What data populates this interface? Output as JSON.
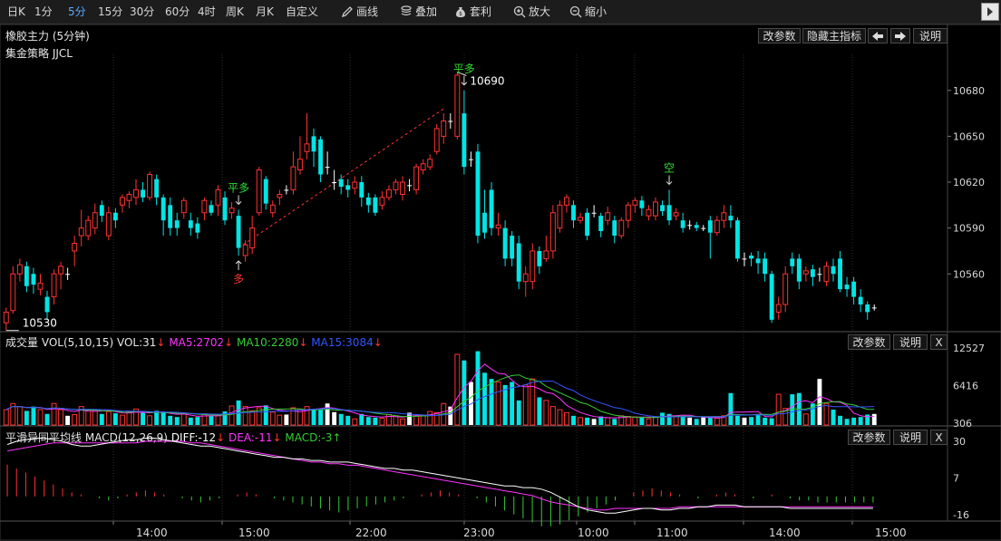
{
  "toolbar": {
    "periods": [
      "日K",
      "1分",
      "5分",
      "15分",
      "30分",
      "60分",
      "4时",
      "周K",
      "月K",
      "自定义"
    ],
    "active_period": "5分",
    "tools": [
      {
        "label": "画线",
        "icon": "pen-icon"
      },
      {
        "label": "叠加",
        "icon": "stack-icon"
      },
      {
        "label": "套利",
        "icon": "money-bag-icon"
      },
      {
        "label": "放大",
        "icon": "zoom-in-icon"
      },
      {
        "label": "缩小",
        "icon": "zoom-out-icon"
      }
    ]
  },
  "main_panel": {
    "title": "橡胶主力 (5分钟)",
    "strategy": "集金策略 JJCL",
    "buttons": {
      "params": "改参数",
      "hide": "隐藏主指标",
      "left": "◀",
      "right": "➡",
      "help": "说明"
    },
    "y_ticks": [
      "10680",
      "10650",
      "10620",
      "10590",
      "10560"
    ],
    "annotations": {
      "high": "10690",
      "low": "10530",
      "signal_close_long_1": "平多",
      "signal_close_long_2": "平多",
      "signal_long": "多",
      "signal_short": "空"
    }
  },
  "volume_panel": {
    "name": "成交量",
    "indicator": "VOL(5,10,15)",
    "vol": "VOL:31",
    "ma5": "MA5:2702",
    "ma10": "MA10:2280",
    "ma15": "MA15:3084",
    "y_ticks": [
      "12527",
      "6416",
      "306"
    ],
    "buttons": {
      "params": "改参数",
      "help": "说明",
      "close": "X"
    }
  },
  "macd_panel": {
    "name": "平滑异同平均线",
    "indicator": "MACD(12,26,9)",
    "diff": "DIFF:-12",
    "dea": "DEA:-11",
    "macd": "MACD:-3",
    "y_ticks": [
      "30",
      "7",
      "-16"
    ],
    "buttons": {
      "params": "改参数",
      "help": "说明",
      "close": "X"
    }
  },
  "x_ticks": [
    "14:00",
    "15:00",
    "22:00",
    "23:00",
    "10:00",
    "11:00",
    "14:00",
    "15:00"
  ],
  "colors": {
    "up": "#ff3232",
    "down": "#00e5e5",
    "flat": "#ffffff",
    "ma5": "#ff33ff",
    "ma10": "#33cc33",
    "ma15": "#3355ff",
    "diff": "#ffffff",
    "dea": "#ff33ff",
    "active": "#5aa9ff"
  },
  "chart_data": [
    {
      "type": "candlestick",
      "title": "橡胶主力 (5分钟)",
      "ylim": [
        10524,
        10700
      ],
      "bars": [
        [
          10528,
          10535,
          10523,
          10538
        ],
        [
          10536,
          10560,
          10534,
          10565
        ],
        [
          10560,
          10566,
          10555,
          10570
        ],
        [
          10565,
          10552,
          10548,
          10568
        ],
        [
          10560,
          10553,
          10547,
          10564
        ],
        [
          10550,
          10554,
          10546,
          10560
        ],
        [
          10545,
          10535,
          10530,
          10549
        ],
        [
          10545,
          10560,
          10540,
          10563
        ],
        [
          10560,
          10565,
          10550,
          10568
        ],
        [
          10560,
          10560,
          10556,
          10564
        ],
        [
          10575,
          10580,
          10565,
          10585
        ],
        [
          10585,
          10590,
          10578,
          10602
        ],
        [
          10585,
          10595,
          10582,
          10598
        ],
        [
          10590,
          10600,
          10586,
          10606
        ],
        [
          10605,
          10598,
          10594,
          10608
        ],
        [
          10585,
          10600,
          10582,
          10604
        ],
        [
          10600,
          10595,
          10590,
          10603
        ],
        [
          10605,
          10610,
          10600,
          10612
        ],
        [
          10608,
          10612,
          10603,
          10614
        ],
        [
          10610,
          10615,
          10605,
          10622
        ],
        [
          10615,
          10610,
          10607,
          10620
        ],
        [
          10610,
          10625,
          10608,
          10627
        ],
        [
          10622,
          10610,
          10605,
          10625
        ],
        [
          10610,
          10595,
          10585,
          10612
        ],
        [
          10605,
          10590,
          10585,
          10610
        ],
        [
          10595,
          10590,
          10585,
          10600
        ],
        [
          10600,
          10608,
          10596,
          10610
        ],
        [
          10595,
          10590,
          10585,
          10600
        ],
        [
          10593,
          10587,
          10583,
          10597
        ],
        [
          10600,
          10608,
          10595,
          10610
        ],
        [
          10605,
          10600,
          10598,
          10608
        ],
        [
          10605,
          10615,
          10598,
          10618
        ],
        [
          10610,
          10595,
          10592,
          10614
        ],
        [
          10600,
          10603,
          10596,
          10607
        ],
        [
          10598,
          10577,
          10572,
          10602
        ],
        [
          10572,
          10579,
          10568,
          10582
        ],
        [
          10577,
          10590,
          10573,
          10598
        ],
        [
          10600,
          10628,
          10598,
          10630
        ],
        [
          10622,
          10606,
          10602,
          10624
        ],
        [
          10600,
          10605,
          10597,
          10608
        ],
        [
          10610,
          10612,
          10605,
          10615
        ],
        [
          10615,
          10615,
          10612,
          10618
        ],
        [
          10615,
          10630,
          10612,
          10640
        ],
        [
          10628,
          10635,
          10625,
          10650
        ],
        [
          10640,
          10645,
          10635,
          10665
        ],
        [
          10650,
          10640,
          10630,
          10655
        ],
        [
          10648,
          10625,
          10620,
          10650
        ],
        [
          10630,
          10630,
          10625,
          10640
        ],
        [
          10620,
          10620,
          10615,
          10628
        ],
        [
          10622,
          10617,
          10612,
          10625
        ],
        [
          10618,
          10615,
          10610,
          10622
        ],
        [
          10616,
          10620,
          10612,
          10624
        ],
        [
          10620,
          10610,
          10604,
          10624
        ],
        [
          10610,
          10605,
          10600,
          10613
        ],
        [
          10610,
          10600,
          10598,
          10612
        ],
        [
          10605,
          10610,
          10602,
          10614
        ],
        [
          10610,
          10615,
          10608,
          10618
        ],
        [
          10615,
          10620,
          10612,
          10622
        ],
        [
          10612,
          10620,
          10608,
          10624
        ],
        [
          10618,
          10618,
          10614,
          10622
        ],
        [
          10615,
          10630,
          10612,
          10632
        ],
        [
          10628,
          10632,
          10625,
          10635
        ],
        [
          10630,
          10635,
          10628,
          10638
        ],
        [
          10640,
          10655,
          10638,
          10658
        ],
        [
          10650,
          10660,
          10645,
          10665
        ],
        [
          10660,
          10660,
          10655,
          10665
        ],
        [
          10650,
          10690,
          10648,
          10692
        ],
        [
          10665,
          10630,
          10625,
          10680
        ],
        [
          10635,
          10635,
          10630,
          10640
        ],
        [
          10640,
          10585,
          10580,
          10645
        ],
        [
          10600,
          10587,
          10583,
          10615
        ],
        [
          10615,
          10590,
          10585,
          10620
        ],
        [
          10590,
          10592,
          10585,
          10600
        ],
        [
          10590,
          10570,
          10565,
          10595
        ],
        [
          10585,
          10570,
          10565,
          10588
        ],
        [
          10580,
          10555,
          10550,
          10585
        ],
        [
          10555,
          10560,
          10545,
          10565
        ],
        [
          10555,
          10575,
          10550,
          10580
        ],
        [
          10575,
          10565,
          10560,
          10578
        ],
        [
          10570,
          10575,
          10568,
          10585
        ],
        [
          10575,
          10600,
          10570,
          10605
        ],
        [
          10590,
          10605,
          10587,
          10608
        ],
        [
          10605,
          10610,
          10600,
          10612
        ],
        [
          10605,
          10595,
          10590,
          10608
        ],
        [
          10595,
          10597,
          10593,
          10600
        ],
        [
          10600,
          10585,
          10582,
          10603
        ],
        [
          10600,
          10600,
          10597,
          10605
        ],
        [
          10598,
          10588,
          10584,
          10600
        ],
        [
          10595,
          10600,
          10592,
          10604
        ],
        [
          10595,
          10585,
          10580,
          10598
        ],
        [
          10585,
          10595,
          10583,
          10597
        ],
        [
          10595,
          10605,
          10590,
          10607
        ],
        [
          10605,
          10608,
          10600,
          10610
        ],
        [
          10608,
          10603,
          10598,
          10611
        ],
        [
          10598,
          10602,
          10595,
          10605
        ],
        [
          10598,
          10607,
          10595,
          10610
        ],
        [
          10605,
          10601,
          10598,
          10608
        ],
        [
          10605,
          10595,
          10592,
          10615
        ],
        [
          10598,
          10600,
          10595,
          10603
        ],
        [
          10595,
          10590,
          10587,
          10600
        ],
        [
          10592,
          10592,
          10589,
          10595
        ],
        [
          10592,
          10590,
          10588,
          10594
        ],
        [
          10590,
          10590,
          10588,
          10592
        ],
        [
          10595,
          10587,
          10570,
          10598
        ],
        [
          10587,
          10595,
          10585,
          10598
        ],
        [
          10595,
          10600,
          10590,
          10605
        ],
        [
          10598,
          10595,
          10590,
          10605
        ],
        [
          10595,
          10570,
          10568,
          10597
        ],
        [
          10570,
          10570,
          10565,
          10574
        ],
        [
          10572,
          10570,
          10565,
          10574
        ],
        [
          10570,
          10567,
          10560,
          10575
        ],
        [
          10570,
          10560,
          10555,
          10574
        ],
        [
          10560,
          10530,
          10528,
          10562
        ],
        [
          10535,
          10540,
          10530,
          10545
        ],
        [
          10540,
          10560,
          10535,
          10565
        ],
        [
          10570,
          10565,
          10560,
          10574
        ],
        [
          10570,
          10555,
          10550,
          10573
        ],
        [
          10560,
          10562,
          10555,
          10565
        ],
        [
          10563,
          10558,
          10552,
          10566
        ],
        [
          10560,
          10560,
          10555,
          10564
        ],
        [
          10555,
          10565,
          10552,
          10568
        ],
        [
          10565,
          10560,
          10555,
          10570
        ],
        [
          10570,
          10550,
          10548,
          10575
        ],
        [
          10553,
          10550,
          10545,
          10558
        ],
        [
          10555,
          10545,
          10540,
          10558
        ],
        [
          10545,
          10540,
          10535,
          10550
        ],
        [
          10540,
          10535,
          10530,
          10542
        ],
        [
          10538,
          10538,
          10536,
          10540
        ]
      ],
      "signal_line": {
        "from_bar": 34,
        "to_bar": 64
      }
    },
    {
      "type": "bar",
      "title": "成交量",
      "ylim": [
        0,
        12527
      ],
      "values": [
        2500,
        3500,
        3000,
        2300,
        3000,
        2500,
        1800,
        3500,
        2500,
        1500,
        1700,
        3000,
        2500,
        2400,
        1800,
        2200,
        1900,
        1600,
        2200,
        2600,
        2000,
        1500,
        2300,
        2200,
        1500,
        1300,
        1800,
        1200,
        1300,
        1800,
        1500,
        1600,
        2200,
        3100,
        4000,
        3000,
        2300,
        2800,
        3200,
        2100,
        1600,
        1700,
        2800,
        2600,
        3000,
        2600,
        2500,
        3500,
        2100,
        1800,
        1500,
        1000,
        1800,
        1300,
        1200,
        1100,
        1700,
        1500,
        1000,
        2000,
        1500,
        1600,
        2200,
        2000,
        3500,
        3000,
        11500,
        10500,
        7000,
        12000,
        8500,
        7500,
        7000,
        6500,
        7000,
        4000,
        6500,
        7500,
        4500,
        4000,
        3000,
        2500,
        2000,
        1500,
        1200,
        1200,
        1000,
        1400,
        1200,
        1000,
        1500,
        1400,
        1300,
        1200,
        1000,
        1300,
        2000,
        1800,
        1500,
        1400,
        1200,
        1000,
        1300,
        1200,
        1100,
        1500,
        5200,
        1500,
        1200,
        1300,
        1800,
        1200,
        1100,
        5000,
        2700,
        5000,
        5200,
        1800,
        3500,
        7500,
        3500,
        2500,
        1500,
        1000,
        1200,
        1300,
        1700,
        1800,
        1800,
        5000,
        2000
      ]
    },
    {
      "type": "bar",
      "title": "平滑异同平均线",
      "ylim": [
        -16,
        30
      ],
      "diff": [
        28,
        30,
        31,
        32,
        32,
        31,
        30,
        28,
        27,
        27,
        28,
        29,
        30,
        31,
        31,
        32,
        32,
        31,
        30,
        29,
        28,
        27,
        27,
        26,
        25,
        24,
        23,
        22,
        21,
        20,
        20,
        19,
        19,
        18,
        18,
        17,
        17,
        17,
        16,
        15,
        14,
        13,
        13,
        12,
        12,
        11,
        10,
        9,
        8,
        7,
        6,
        5,
        4,
        3,
        2,
        2,
        1,
        1,
        0,
        -2,
        -5,
        -8,
        -11,
        -13,
        -14,
        -15,
        -15,
        -14,
        -13,
        -12,
        -12,
        -13,
        -13,
        -12,
        -12,
        -11,
        -11,
        -10,
        -10,
        -10,
        -11,
        -11,
        -11,
        -11,
        -11,
        -12,
        -12,
        -12,
        -12,
        -12,
        -12,
        -12,
        -12,
        -12,
        -12
      ],
      "dea": [
        24,
        25,
        26,
        27,
        28,
        29,
        29,
        29,
        29,
        29,
        29,
        29,
        29,
        29,
        29,
        30,
        30,
        30,
        30,
        30,
        29,
        29,
        28,
        27,
        26,
        25,
        24,
        23,
        22,
        21,
        20,
        19,
        18,
        17,
        17,
        16,
        16,
        15,
        15,
        14,
        13,
        12,
        11,
        10,
        9,
        8,
        7,
        6,
        5,
        4,
        3,
        2,
        1,
        0,
        -1,
        -2,
        -3,
        -4,
        -6,
        -8,
        -9,
        -10,
        -11,
        -12,
        -13,
        -13,
        -12,
        -12,
        -12,
        -12,
        -12,
        -12,
        -12,
        -11,
        -11,
        -11,
        -11,
        -11,
        -11,
        -11,
        -11,
        -11,
        -11,
        -11,
        -11,
        -11,
        -11,
        -11,
        -11,
        -11,
        -11,
        -11,
        -11,
        -11,
        -11
      ],
      "macd": [
        16,
        14,
        12,
        10,
        8,
        6,
        4,
        2,
        1,
        0,
        -1,
        -2,
        -1,
        1,
        2,
        3,
        2,
        1,
        0,
        -1,
        -2,
        -3,
        -2,
        -1,
        0,
        1,
        2,
        1,
        0,
        -1,
        -2,
        -3,
        -4,
        -5,
        -6,
        -7,
        -8,
        -7,
        -6,
        -5,
        -4,
        -3,
        -2,
        -1,
        0,
        1,
        2,
        3,
        2,
        1,
        0,
        -1,
        -3,
        -5,
        -7,
        -9,
        -11,
        -13,
        -15,
        -15,
        -14,
        -12,
        -10,
        -8,
        -6,
        -4,
        -2,
        0,
        2,
        3,
        4,
        3,
        2,
        1,
        0,
        -1,
        0,
        1,
        2,
        1,
        0,
        -1,
        0,
        1,
        0,
        -1,
        -2,
        -2,
        -3,
        -3,
        -3,
        -3,
        -3,
        -3,
        -3
      ]
    }
  ]
}
